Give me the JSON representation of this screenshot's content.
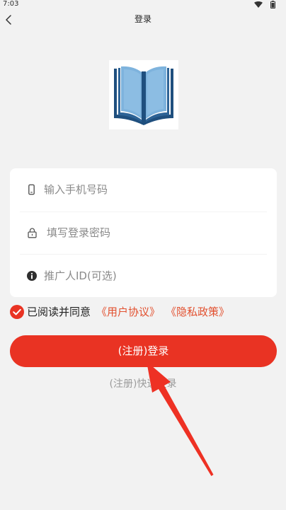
{
  "status_bar": {
    "time": "7:03",
    "wifi_icon": "wifi-icon",
    "battery_icon": "battery-icon"
  },
  "header": {
    "back_icon": "chevron-left-icon",
    "title": "登录"
  },
  "logo": {
    "icon": "open-book-logo"
  },
  "form": {
    "phone": {
      "icon": "phone-icon",
      "placeholder": "输入手机号码"
    },
    "password": {
      "icon": "lock-icon",
      "placeholder": "填写登录密码"
    },
    "referrer": {
      "icon": "info-icon",
      "placeholder": "推广人ID(可选)"
    }
  },
  "agreement": {
    "checked": true,
    "check_icon": "checkmark-circle-icon",
    "text": "已阅读并同意",
    "user_agreement": "《用户协议》",
    "privacy_policy": "《隐私政策》"
  },
  "login_button": {
    "label": "(注册)登录"
  },
  "quick_login": {
    "label": "(注册)快速登录"
  },
  "annotation": {
    "icon": "red-arrow-annotation"
  },
  "colors": {
    "background": "#f2f2f2",
    "card": "#ffffff",
    "accent": "#e93323",
    "link": "#e2502f",
    "placeholder": "#8a8a8a",
    "book_blue": "#7eb3dd",
    "book_navy": "#1f4f7e"
  }
}
